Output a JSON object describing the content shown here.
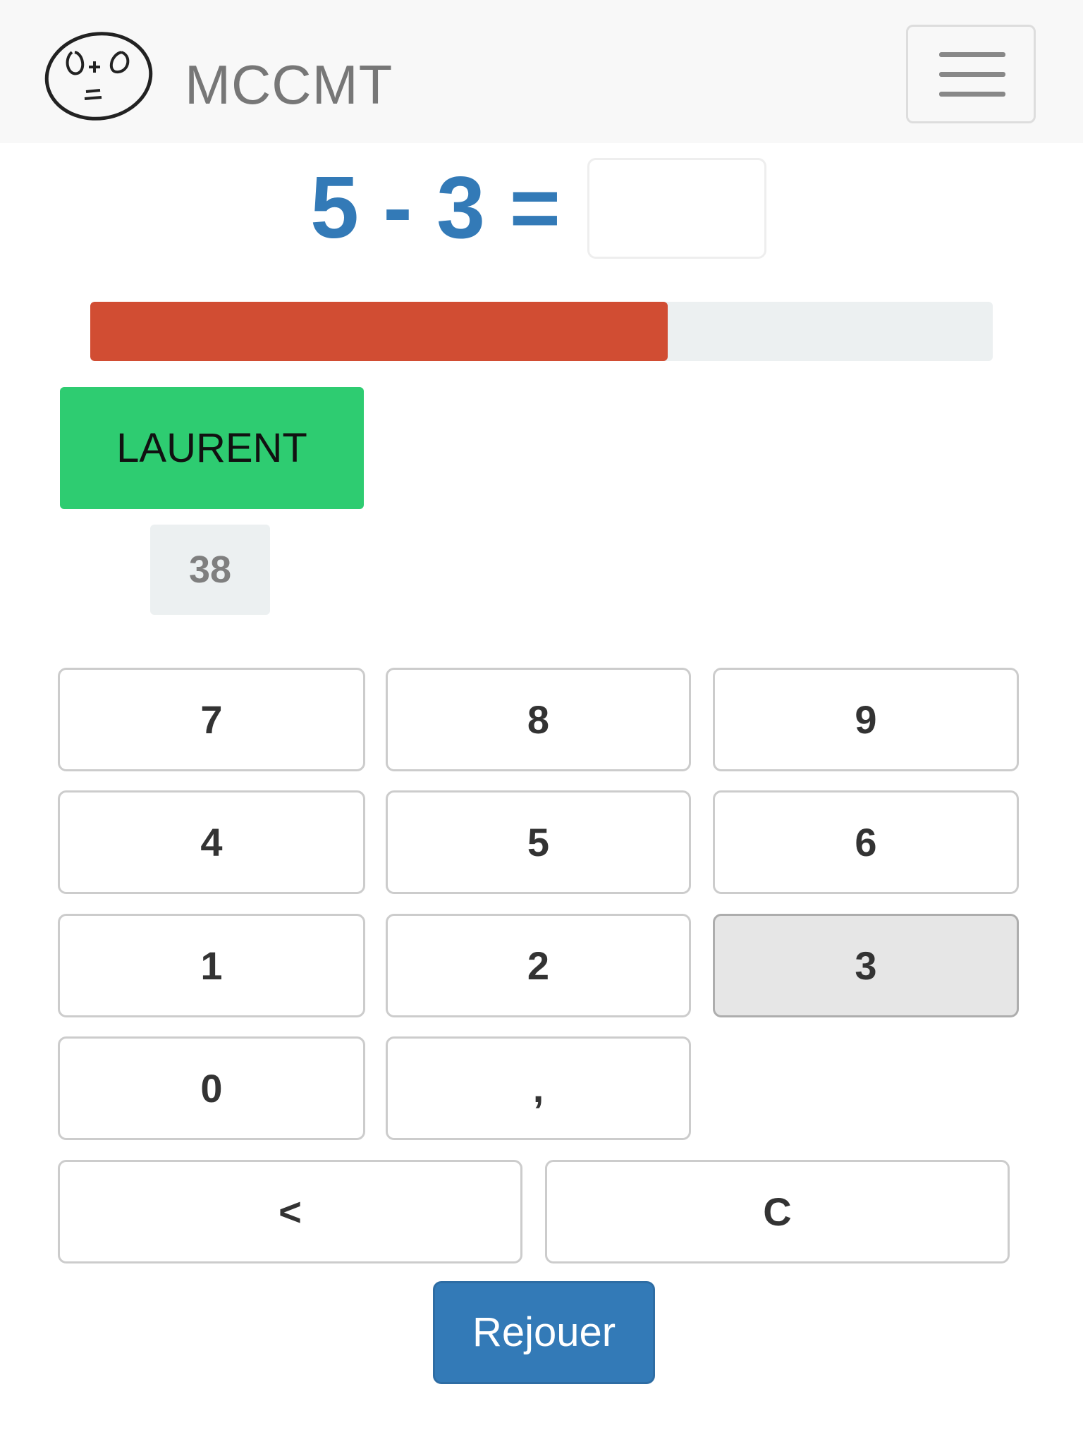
{
  "app": {
    "brand": "MCCMT",
    "logo_icon": "math-face-logo-icon",
    "menu_icon": "hamburger-menu-icon"
  },
  "question": {
    "equation": "5 - 3 =",
    "answer_value": "",
    "equation_color": "#337ab7"
  },
  "timer": {
    "progress_fraction": 0.64,
    "fill_color": "#d14d33",
    "track_color": "#ecf0f1"
  },
  "player": {
    "name": "LAURENT",
    "score": "38",
    "color": "#2ecc71"
  },
  "keypad": {
    "keys": [
      "7",
      "8",
      "9",
      "4",
      "5",
      "6",
      "1",
      "2",
      "3",
      "0",
      ","
    ],
    "pressed_key": "3",
    "backspace_label": "<",
    "clear_label": "C"
  },
  "replay_label": "Rejouer",
  "colors": {
    "primary": "#337ab7",
    "navbar_bg": "#f8f8f8"
  }
}
